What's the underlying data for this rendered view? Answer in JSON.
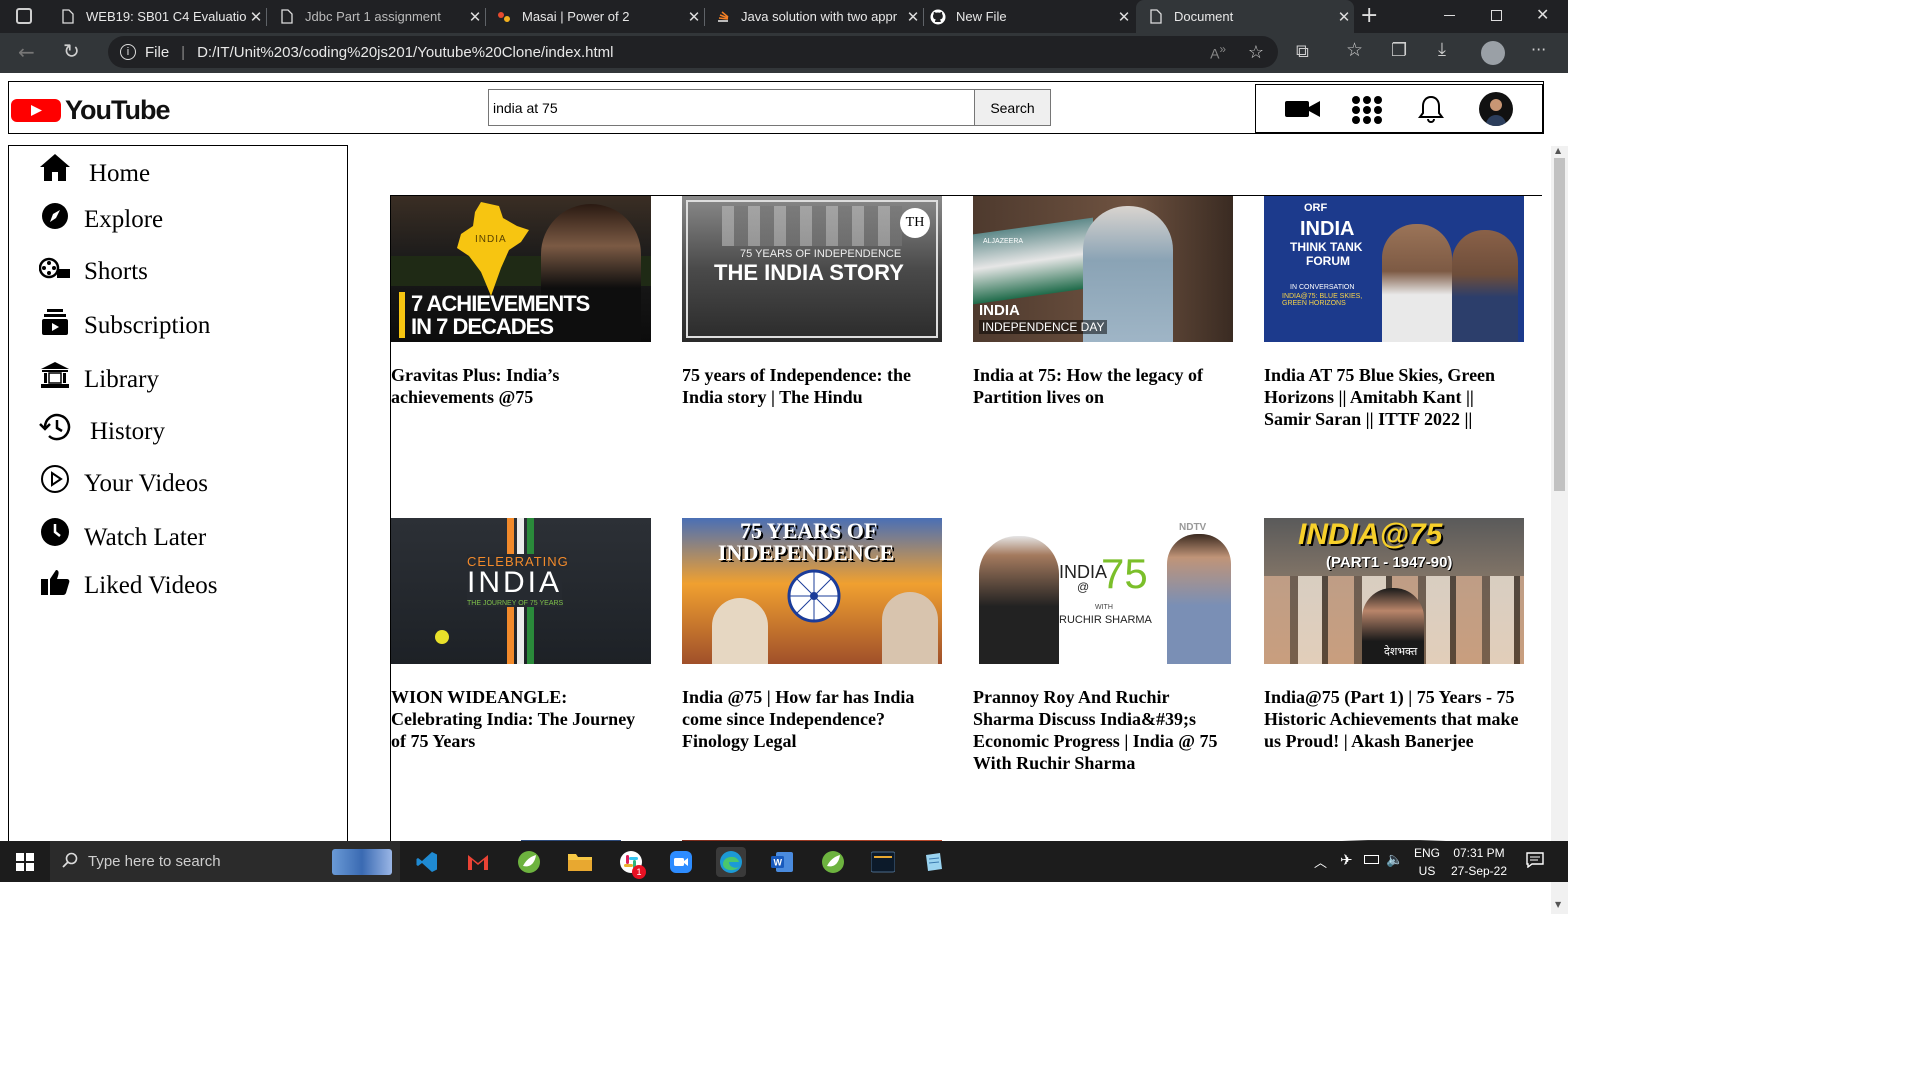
{
  "browser": {
    "tabs": [
      {
        "title": "WEB19: SB01 C4 Evaluation",
        "icon": "document-icon"
      },
      {
        "title": "Jdbc Part 1 assignment",
        "icon": "document-icon"
      },
      {
        "title": "Masai | Power of 2",
        "icon": "masai-icon"
      },
      {
        "title": "Java solution with two appr",
        "icon": "stack-icon"
      },
      {
        "title": "New File",
        "icon": "github-icon"
      },
      {
        "title": "Document",
        "icon": "document-icon"
      }
    ],
    "active_tab": "Document",
    "url_scheme": "File",
    "url": "D:/IT/Unit%203/coding%20js201/Youtube%20Clone/index.html"
  },
  "header": {
    "logo_text": "YouTube",
    "search_value": "india at 75",
    "search_button": "Search"
  },
  "sidebar": {
    "items": [
      {
        "label": "Home",
        "icon": "home-icon"
      },
      {
        "label": "Explore",
        "icon": "compass-icon"
      },
      {
        "label": "Shorts",
        "icon": "shorts-icon"
      },
      {
        "label": "Subscription",
        "icon": "subscription-icon"
      },
      {
        "label": "Library",
        "icon": "library-icon"
      },
      {
        "label": "History",
        "icon": "history-icon"
      },
      {
        "label": "Your Videos",
        "icon": "play-icon"
      },
      {
        "label": "Watch Later",
        "icon": "clock-icon"
      },
      {
        "label": "Liked Videos",
        "icon": "thumbs-up-icon"
      }
    ]
  },
  "videos": [
    {
      "title": "Gravitas Plus: India’s achievements @75",
      "thumb_lines": [
        "7 ACHIEVEMENTS",
        "IN 7 DECADES"
      ],
      "thumb_tag": "INDIA"
    },
    {
      "title": "75 years of Independence: the India story | The Hindu",
      "thumb_lines": [
        "75 YEARS OF INDEPENDENCE",
        "THE INDIA STORY"
      ],
      "thumb_tag": "TH"
    },
    {
      "title": "India at 75: How the legacy of Partition lives on",
      "thumb_lines": [
        "INDIA",
        "INDEPENDENCE DAY"
      ],
      "thumb_tag": "ALJAZEERA"
    },
    {
      "title": "India AT 75 Blue Skies, Green Horizons || Amitabh Kant || Samir Saran || ITTF 2022 ||",
      "thumb_lines": [
        "INDIA",
        "THINK TANK",
        "FORUM",
        "IN CONVERSATION",
        "INDIA@75: BLUE SKIES, GREEN HORIZONS"
      ],
      "thumb_tag": "ORF"
    },
    {
      "title": "WION WIDEANGLE: Celebrating India: The Journey of 75 Years",
      "thumb_lines": [
        "CELEBRATING",
        "INDIA",
        "THE JOURNEY OF 75 YEARS"
      ],
      "thumb_tag": ""
    },
    {
      "title": "India @75 | How far has India come since Independence? Finology Legal",
      "thumb_lines": [
        "75 YEARS OF",
        "INDEPENDENCE"
      ],
      "thumb_tag": ""
    },
    {
      "title": "Prannoy Roy And Ruchir Sharma Discuss India&#39;s Economic Progress | India @ 75 With Ruchir Sharma",
      "thumb_lines": [
        "INDIA",
        "@",
        "75",
        "WITH",
        "RUCHIR SHARMA"
      ],
      "thumb_tag": "NDTV"
    },
    {
      "title": "India@75 (Part 1) | 75 Years - 75 Historic Achievements that make us Proud! | Akash Banerjee",
      "thumb_lines": [
        "INDIA@75",
        "(PART1 - 1947-90)"
      ],
      "thumb_tag": "देशभक्त"
    }
  ],
  "taskbar": {
    "search_placeholder": "Type here to search",
    "lang": "ENG",
    "region": "US",
    "time": "07:31 PM",
    "date": "27-Sep-22",
    "notification_badge": "1"
  },
  "colors": {
    "yt_red": "#ff0000",
    "tabbar": "#202124",
    "toolbar": "#323639",
    "taskbar": "#1c1c1c"
  }
}
